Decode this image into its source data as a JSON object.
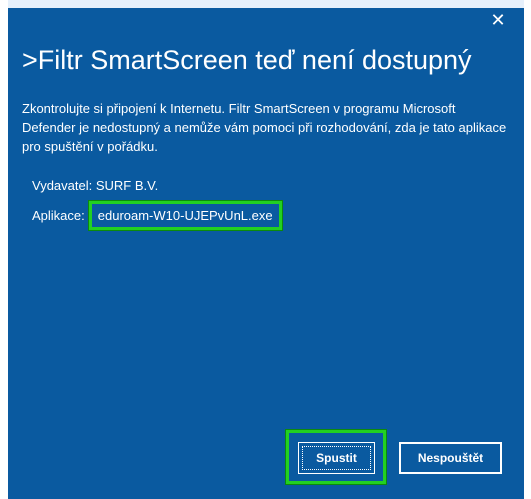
{
  "window": {
    "title": ">Filtr SmartScreen teď není dostupný",
    "close_glyph": "✕"
  },
  "message": {
    "description": "Zkontrolujte si připojení k Internetu. Filtr SmartScreen v programu Microsoft Defender je nedostupný a nemůže vám pomoci při rozhodování, zda je tato aplikace pro spuštění v pořádku."
  },
  "details": {
    "publisher_label": "Vydavatel:",
    "publisher_value": "SURF B.V.",
    "app_label": "Aplikace:",
    "app_value": "eduroam-W10-UJEPvUnL.exe"
  },
  "buttons": {
    "run_label": "Spustit",
    "dont_run_label": "Nespouštět"
  },
  "colors": {
    "background": "#0a5aa0",
    "highlight": "#22d022",
    "text": "#ffffff"
  }
}
